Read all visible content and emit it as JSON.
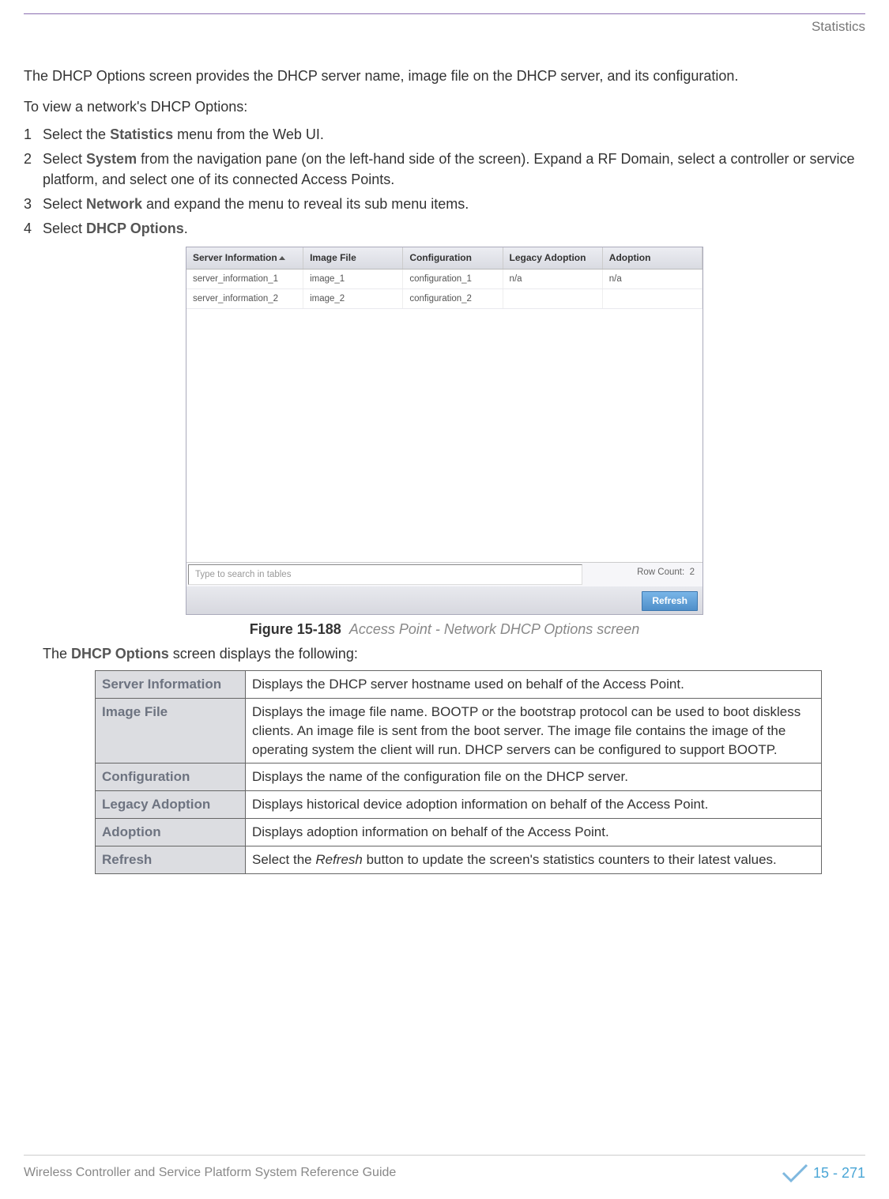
{
  "header": {
    "section": "Statistics"
  },
  "intro": "The DHCP Options screen provides the DHCP server name, image file on the DHCP server, and its configuration.",
  "subintro": "To view a network's DHCP Options:",
  "steps": [
    {
      "num": "1",
      "pre": "Select the ",
      "bold": "Statistics",
      "post": " menu from the Web UI."
    },
    {
      "num": "2",
      "pre": "Select ",
      "bold": "System",
      "post": " from the navigation pane (on the left-hand side of the screen). Expand a RF Domain, select a controller or service platform, and select one of its connected Access Points."
    },
    {
      "num": "3",
      "pre": "Select ",
      "bold": "Network",
      "post": " and expand the menu to reveal its sub menu items."
    },
    {
      "num": "4",
      "pre": "Select ",
      "bold": "DHCP Options",
      "post": "."
    }
  ],
  "figure": {
    "columns": [
      "Server Information",
      "Image File",
      "Configuration",
      "Legacy Adoption",
      "Adoption"
    ],
    "rows": [
      {
        "server": "server_information_1",
        "image": "image_1",
        "config": "configuration_1",
        "legacy": "n/a",
        "adoption": "n/a"
      },
      {
        "server": "server_information_2",
        "image": "image_2",
        "config": "configuration_2",
        "legacy": "",
        "adoption": ""
      }
    ],
    "search_placeholder": "Type to search in tables",
    "row_count_label": "Row Count:",
    "row_count_value": "2",
    "refresh_label": "Refresh",
    "caption_label": "Figure 15-188",
    "caption_text": "Access Point - Network DHCP Options screen"
  },
  "subnote_pre": "The ",
  "subnote_bold": "DHCP Options",
  "subnote_post": " screen displays the following:",
  "table": [
    {
      "key": "Server Information",
      "val": "Displays the DHCP server hostname used on behalf of the Access Point."
    },
    {
      "key": "Image File",
      "val": "Displays the image file name. BOOTP or the bootstrap protocol can be used to boot diskless clients. An image file is sent from the boot server. The image file contains the image of the operating system the client will run. DHCP servers can be configured to support BOOTP."
    },
    {
      "key": "Configuration",
      "val": "Displays the name of the configuration file on the DHCP server."
    },
    {
      "key": "Legacy Adoption",
      "val": "Displays historical device adoption information on behalf of the Access Point."
    },
    {
      "key": "Adoption",
      "val": "Displays adoption information on behalf of the Access Point."
    },
    {
      "key": "Refresh",
      "val_pre": "Select the ",
      "val_em": "Refresh",
      "val_post": " button to update the screen's statistics counters to their latest values."
    }
  ],
  "footer": {
    "guide": "Wireless Controller and Service Platform System Reference Guide",
    "page": "15 - 271"
  }
}
